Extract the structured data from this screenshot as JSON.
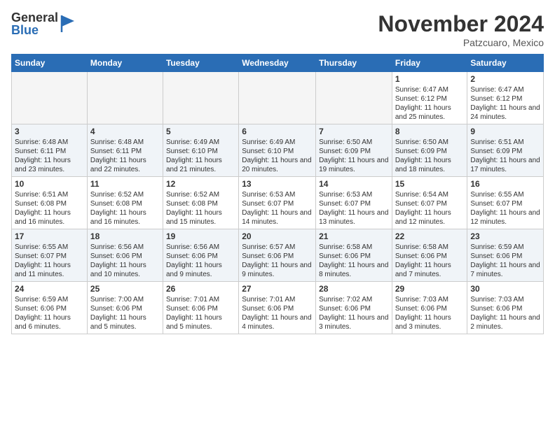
{
  "logo": {
    "general": "General",
    "blue": "Blue"
  },
  "header": {
    "month": "November 2024",
    "location": "Patzcuaro, Mexico"
  },
  "weekdays": [
    "Sunday",
    "Monday",
    "Tuesday",
    "Wednesday",
    "Thursday",
    "Friday",
    "Saturday"
  ],
  "weeks": [
    [
      {
        "day": "",
        "info": ""
      },
      {
        "day": "",
        "info": ""
      },
      {
        "day": "",
        "info": ""
      },
      {
        "day": "",
        "info": ""
      },
      {
        "day": "",
        "info": ""
      },
      {
        "day": "1",
        "info": "Sunrise: 6:47 AM\nSunset: 6:12 PM\nDaylight: 11 hours and 25 minutes."
      },
      {
        "day": "2",
        "info": "Sunrise: 6:47 AM\nSunset: 6:12 PM\nDaylight: 11 hours and 24 minutes."
      }
    ],
    [
      {
        "day": "3",
        "info": "Sunrise: 6:48 AM\nSunset: 6:11 PM\nDaylight: 11 hours and 23 minutes."
      },
      {
        "day": "4",
        "info": "Sunrise: 6:48 AM\nSunset: 6:11 PM\nDaylight: 11 hours and 22 minutes."
      },
      {
        "day": "5",
        "info": "Sunrise: 6:49 AM\nSunset: 6:10 PM\nDaylight: 11 hours and 21 minutes."
      },
      {
        "day": "6",
        "info": "Sunrise: 6:49 AM\nSunset: 6:10 PM\nDaylight: 11 hours and 20 minutes."
      },
      {
        "day": "7",
        "info": "Sunrise: 6:50 AM\nSunset: 6:09 PM\nDaylight: 11 hours and 19 minutes."
      },
      {
        "day": "8",
        "info": "Sunrise: 6:50 AM\nSunset: 6:09 PM\nDaylight: 11 hours and 18 minutes."
      },
      {
        "day": "9",
        "info": "Sunrise: 6:51 AM\nSunset: 6:09 PM\nDaylight: 11 hours and 17 minutes."
      }
    ],
    [
      {
        "day": "10",
        "info": "Sunrise: 6:51 AM\nSunset: 6:08 PM\nDaylight: 11 hours and 16 minutes."
      },
      {
        "day": "11",
        "info": "Sunrise: 6:52 AM\nSunset: 6:08 PM\nDaylight: 11 hours and 16 minutes."
      },
      {
        "day": "12",
        "info": "Sunrise: 6:52 AM\nSunset: 6:08 PM\nDaylight: 11 hours and 15 minutes."
      },
      {
        "day": "13",
        "info": "Sunrise: 6:53 AM\nSunset: 6:07 PM\nDaylight: 11 hours and 14 minutes."
      },
      {
        "day": "14",
        "info": "Sunrise: 6:53 AM\nSunset: 6:07 PM\nDaylight: 11 hours and 13 minutes."
      },
      {
        "day": "15",
        "info": "Sunrise: 6:54 AM\nSunset: 6:07 PM\nDaylight: 11 hours and 12 minutes."
      },
      {
        "day": "16",
        "info": "Sunrise: 6:55 AM\nSunset: 6:07 PM\nDaylight: 11 hours and 12 minutes."
      }
    ],
    [
      {
        "day": "17",
        "info": "Sunrise: 6:55 AM\nSunset: 6:07 PM\nDaylight: 11 hours and 11 minutes."
      },
      {
        "day": "18",
        "info": "Sunrise: 6:56 AM\nSunset: 6:06 PM\nDaylight: 11 hours and 10 minutes."
      },
      {
        "day": "19",
        "info": "Sunrise: 6:56 AM\nSunset: 6:06 PM\nDaylight: 11 hours and 9 minutes."
      },
      {
        "day": "20",
        "info": "Sunrise: 6:57 AM\nSunset: 6:06 PM\nDaylight: 11 hours and 9 minutes."
      },
      {
        "day": "21",
        "info": "Sunrise: 6:58 AM\nSunset: 6:06 PM\nDaylight: 11 hours and 8 minutes."
      },
      {
        "day": "22",
        "info": "Sunrise: 6:58 AM\nSunset: 6:06 PM\nDaylight: 11 hours and 7 minutes."
      },
      {
        "day": "23",
        "info": "Sunrise: 6:59 AM\nSunset: 6:06 PM\nDaylight: 11 hours and 7 minutes."
      }
    ],
    [
      {
        "day": "24",
        "info": "Sunrise: 6:59 AM\nSunset: 6:06 PM\nDaylight: 11 hours and 6 minutes."
      },
      {
        "day": "25",
        "info": "Sunrise: 7:00 AM\nSunset: 6:06 PM\nDaylight: 11 hours and 5 minutes."
      },
      {
        "day": "26",
        "info": "Sunrise: 7:01 AM\nSunset: 6:06 PM\nDaylight: 11 hours and 5 minutes."
      },
      {
        "day": "27",
        "info": "Sunrise: 7:01 AM\nSunset: 6:06 PM\nDaylight: 11 hours and 4 minutes."
      },
      {
        "day": "28",
        "info": "Sunrise: 7:02 AM\nSunset: 6:06 PM\nDaylight: 11 hours and 3 minutes."
      },
      {
        "day": "29",
        "info": "Sunrise: 7:03 AM\nSunset: 6:06 PM\nDaylight: 11 hours and 3 minutes."
      },
      {
        "day": "30",
        "info": "Sunrise: 7:03 AM\nSunset: 6:06 PM\nDaylight: 11 hours and 2 minutes."
      }
    ]
  ]
}
